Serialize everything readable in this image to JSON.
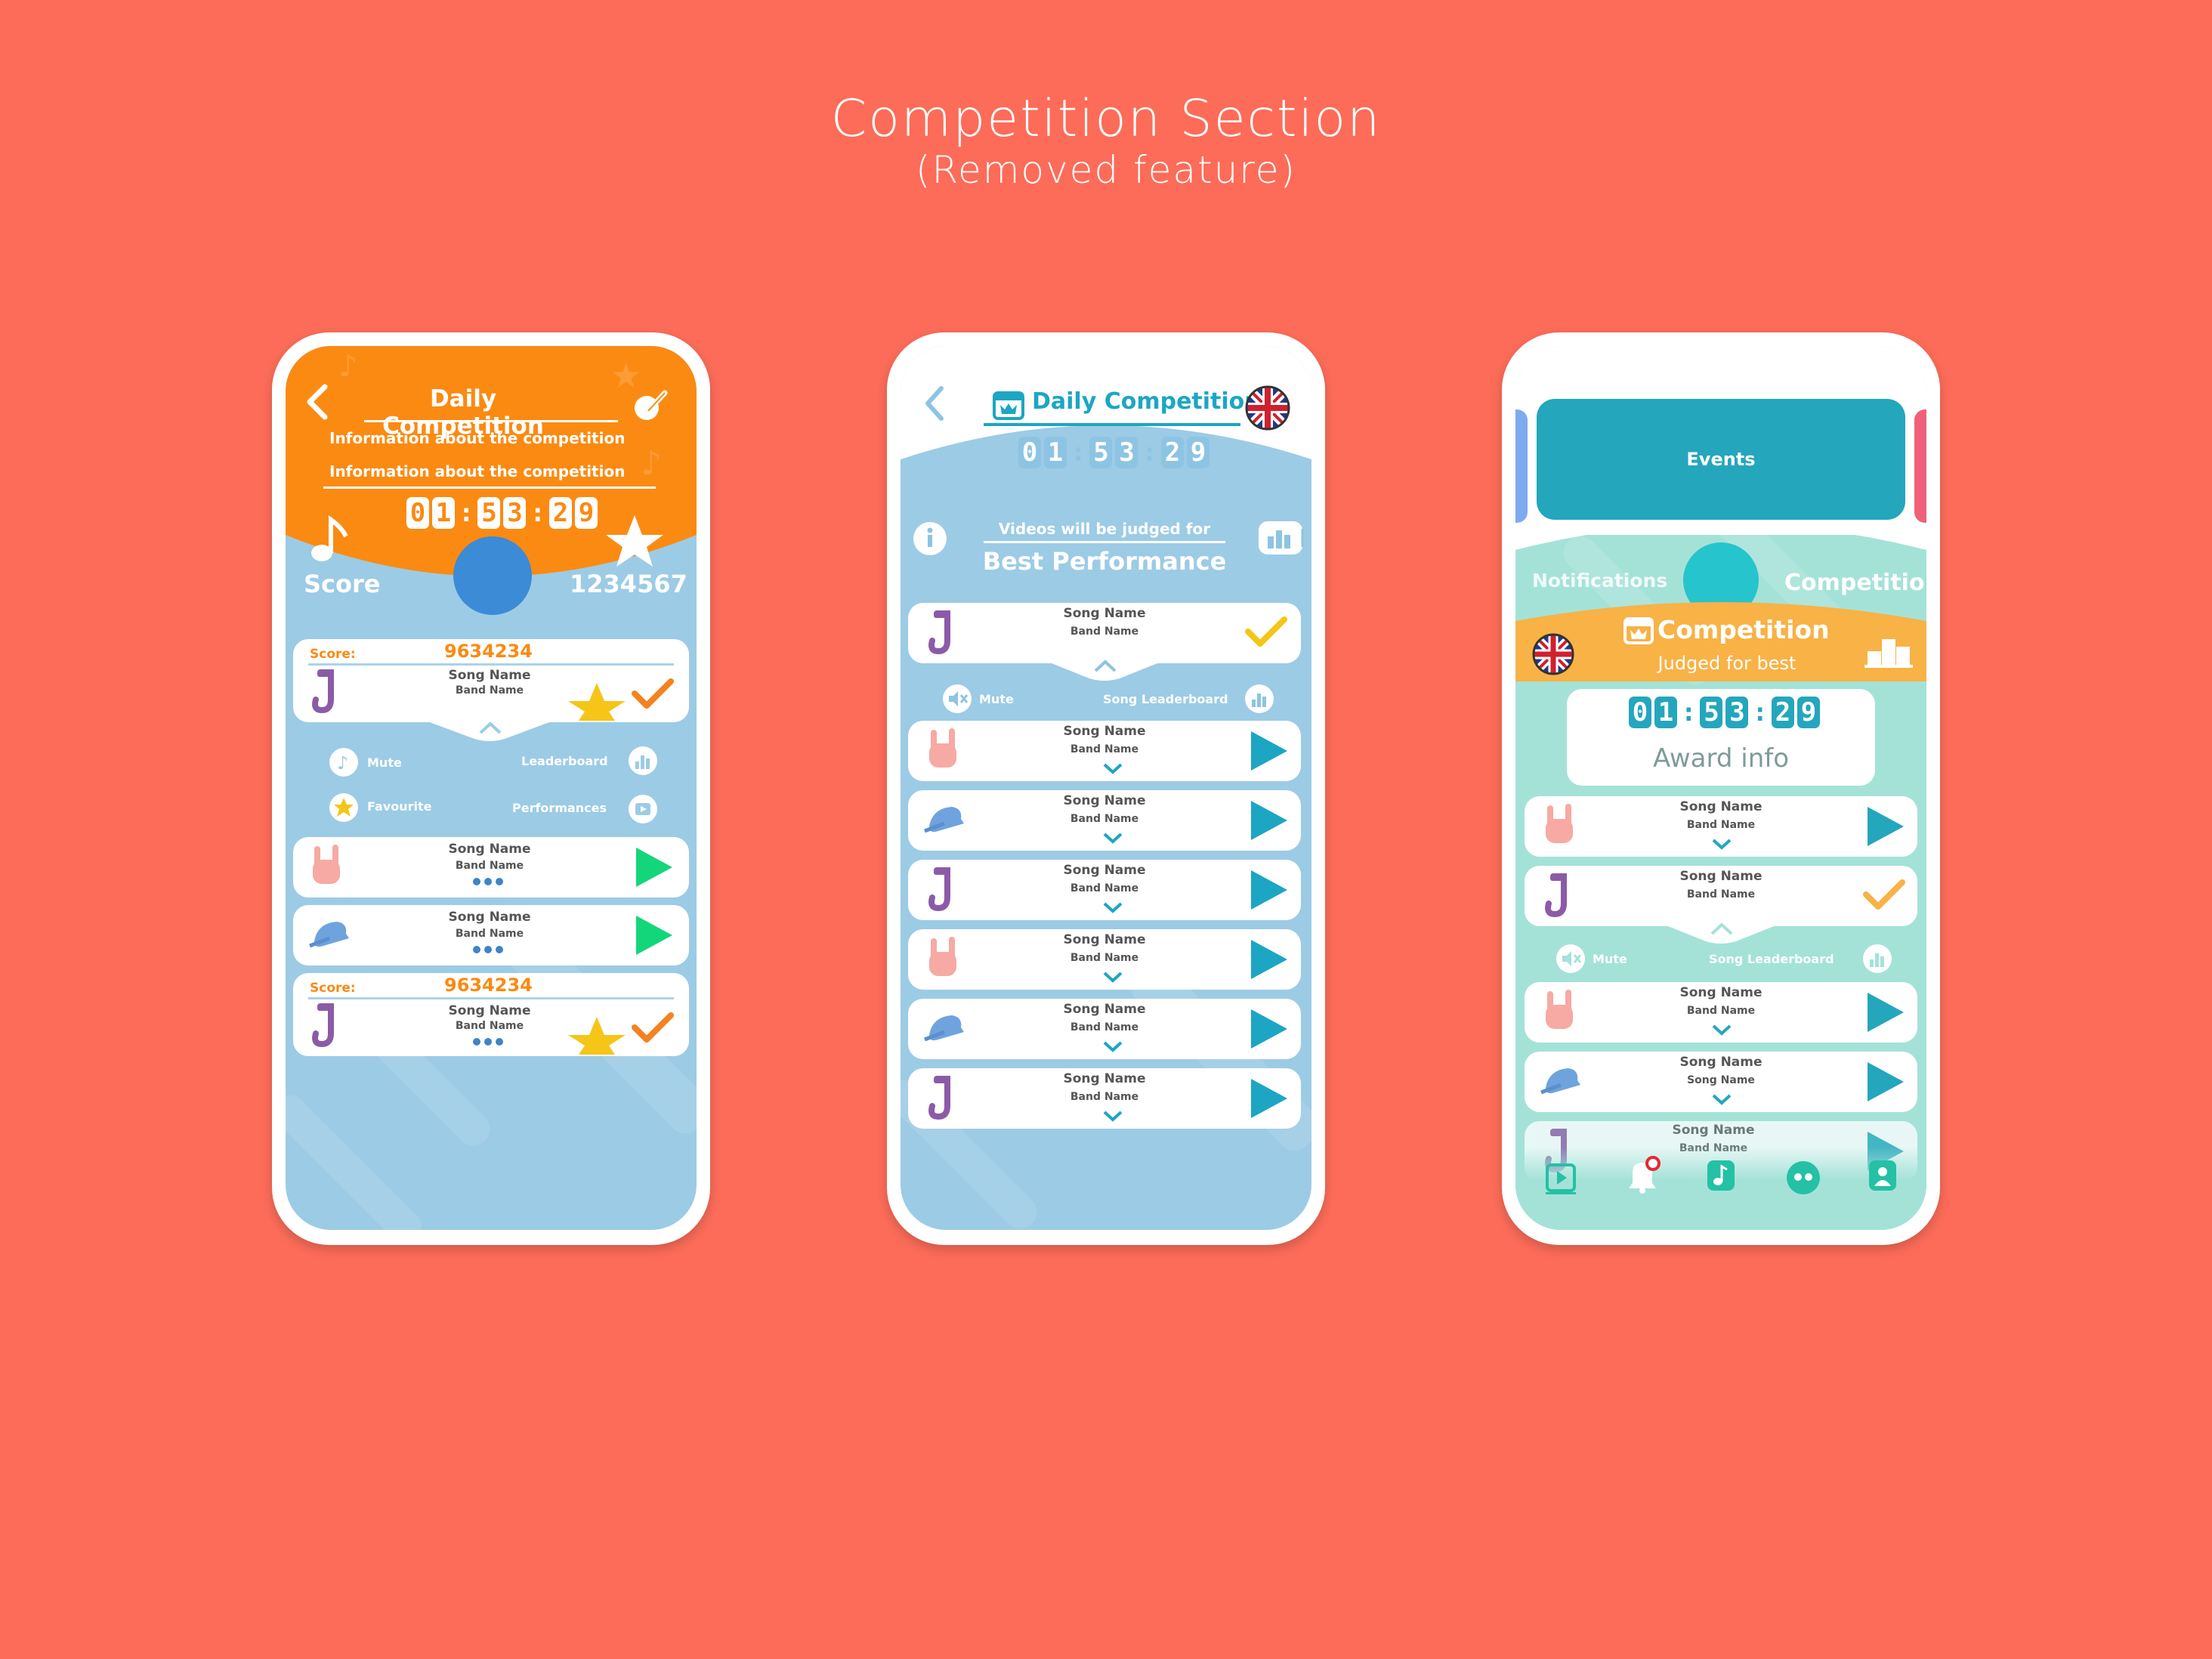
{
  "page": {
    "title": "Competition Section",
    "subtitle": "(Removed feature)"
  },
  "phone1": {
    "title": "Daily Competition",
    "info_line1": "Information about the competition",
    "info_line2": "Information about the competition",
    "timer": [
      "0",
      "1",
      ":",
      "5",
      "3",
      ":",
      "2",
      "9"
    ],
    "score_label": "Score",
    "score_value": "1234567",
    "card1": {
      "score_label": "Score:",
      "score": "9634234",
      "song": "Song Name",
      "band": "Band Name"
    },
    "actions": {
      "mute": "Mute",
      "leaderboard": "Leaderboard",
      "favourite": "Favourite",
      "performances": "Performances"
    },
    "card2": {
      "song": "Song Name",
      "band": "Band Name"
    },
    "card3": {
      "song": "Song Name",
      "band": "Band Name"
    },
    "card4": {
      "score_label": "Score:",
      "score": "9634234",
      "song": "Song Name",
      "band": "Band Name"
    },
    "colors": {
      "header": "#fb8a12",
      "accent_blue": "#3b8bd6",
      "play_green": "#13d67a",
      "check_orange": "#f5821f"
    }
  },
  "phone2": {
    "title": "Daily Competition",
    "timer": [
      "0",
      "1",
      ":",
      "5",
      "3",
      ":",
      "2",
      "9"
    ],
    "judged_label": "Videos will be judged for",
    "criteria": "Best Performance",
    "expanded": {
      "song": "Song Name",
      "band": "Band Name",
      "mute": "Mute",
      "leaderboard": "Song Leaderboard"
    },
    "rows": [
      {
        "song": "Song Name",
        "band": "Band Name",
        "icon": "rock-hand-icon"
      },
      {
        "song": "Song Name",
        "band": "Band Name",
        "icon": "cap-icon"
      },
      {
        "song": "Song Name",
        "band": "Band Name",
        "icon": "saxophone-icon"
      },
      {
        "song": "Song Name",
        "band": "Band Name",
        "icon": "rock-hand-icon"
      },
      {
        "song": "Song Name",
        "band": "Band Name",
        "icon": "cap-icon"
      },
      {
        "song": "Song Name",
        "band": "Band Name",
        "icon": "saxophone-icon"
      }
    ],
    "colors": {
      "accent": "#1ca6c4",
      "check_yellow": "#f5c518"
    }
  },
  "phone3": {
    "events_label": "Events",
    "notifications_tab": "Notifications",
    "competition_tab": "Competition",
    "banner_title": "Competition",
    "banner_subtitle": "Judged for best",
    "timer": [
      "0",
      "1",
      ":",
      "5",
      "3",
      ":",
      "2",
      "9"
    ],
    "award_info": "Award info",
    "rows": [
      {
        "song": "Song Name",
        "band": "Band Name"
      },
      {
        "song": "Song Name",
        "band": "Band Name"
      },
      {
        "song": "Song Name",
        "band": "Band Name"
      },
      {
        "song": "Song Name",
        "band": "Song Name"
      },
      {
        "song": "Song Name",
        "band": "Band Name"
      }
    ],
    "expanded": {
      "mute": "Mute",
      "leaderboard": "Song Leaderboard"
    },
    "colors": {
      "teal": "#24a6bd",
      "mint": "#a4e2d8",
      "banner": "#f8b246"
    }
  }
}
